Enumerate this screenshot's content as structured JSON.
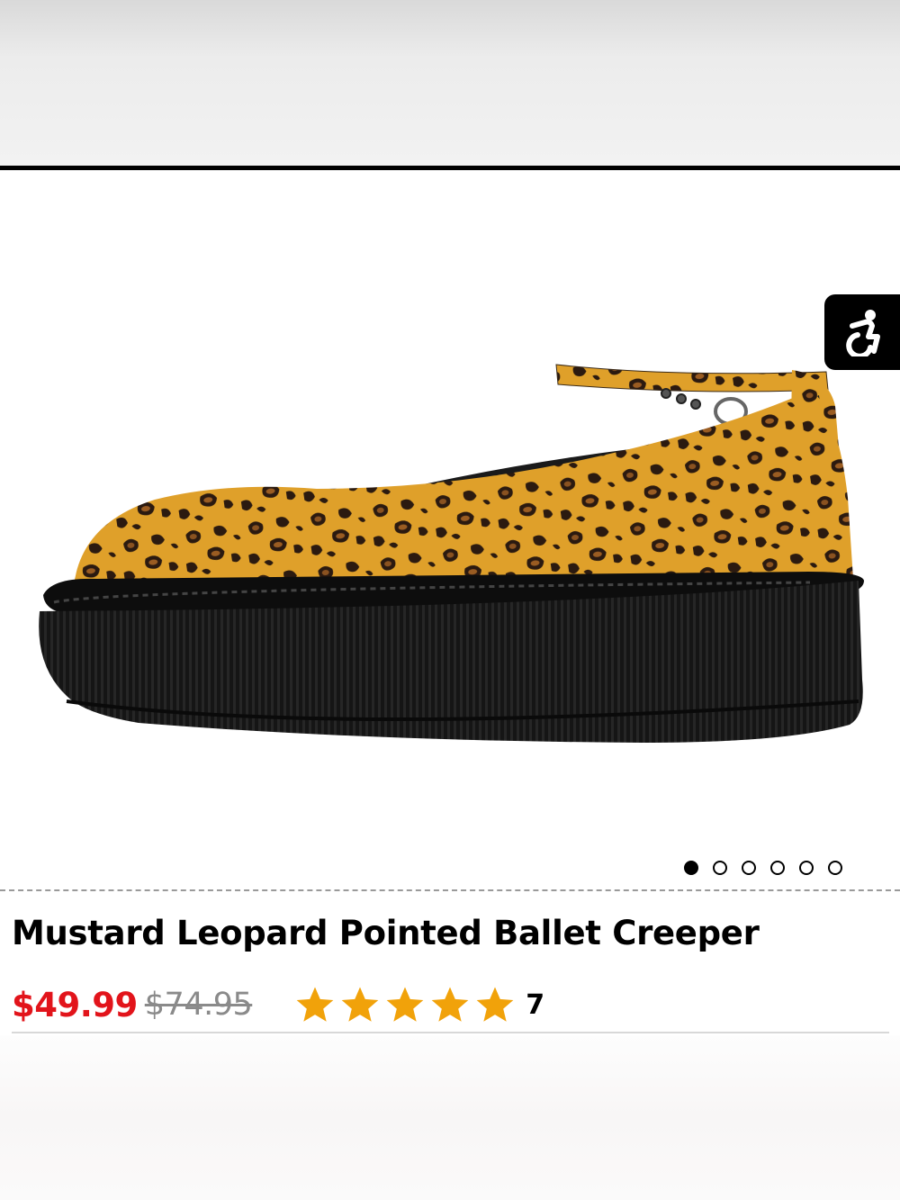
{
  "product": {
    "title": "Mustard Leopard Pointed Ballet Creeper",
    "image_alt": "Mustard leopard print ballet creeper shoe with ankle strap",
    "price": "$49.99",
    "original_price": "$74.95",
    "rating": 5,
    "review_count": "7"
  },
  "carousel": {
    "total": 6,
    "active_index": 0
  },
  "colors": {
    "price_red": "#e2141b",
    "star_gold": "#f1a20a",
    "leopard_base": "#e0a020"
  },
  "icons": {
    "accessibility": "accessibility-icon",
    "star": "star-icon"
  }
}
